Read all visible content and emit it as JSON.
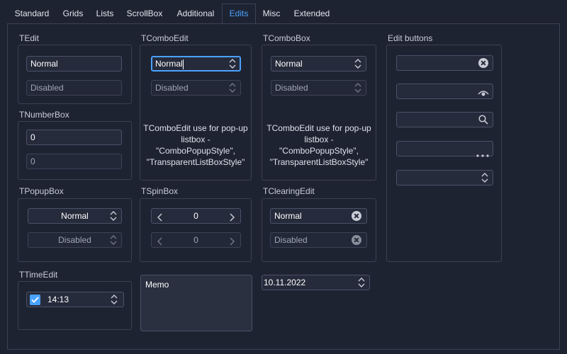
{
  "tabs": [
    "Standard",
    "Grids",
    "Lists",
    "ScrollBox",
    "Additional",
    "Edits",
    "Misc",
    "Extended"
  ],
  "active_tab": "Edits",
  "tedit": {
    "title": "TEdit",
    "normal": "Normal",
    "disabled": "Disabled"
  },
  "tnumberbox": {
    "title": "TNumberBox",
    "value1": "0",
    "value2": "0"
  },
  "tpopupbox": {
    "title": "TPopupBox",
    "normal": "Normal",
    "disabled": "Disabled"
  },
  "ttimeedit": {
    "title": "TTimeEdit",
    "value": "14:13"
  },
  "tcomboedit": {
    "title": "TComboEdit",
    "normal": "Normal",
    "disabled": "Disabled",
    "hint": [
      "TComboEdit use for pop-up",
      "listbox -",
      "\"ComboPopupStyle\",",
      "\"TransparentListBoxStyle\""
    ]
  },
  "tspinbox": {
    "title": "TSpinBox",
    "value1": "0",
    "value2": "0"
  },
  "memo": {
    "text": "Memo"
  },
  "tcombobox": {
    "title": "TComboBox",
    "normal": "Normal",
    "disabled": "Disabled",
    "hint": [
      "TComboEdit use for pop-up",
      "listbox -",
      "\"ComboPopupStyle\",",
      "\"TransparentListBoxStyle\""
    ]
  },
  "tclearingedit": {
    "title": "TClearingEdit",
    "normal": "Normal",
    "disabled": "Disabled"
  },
  "dateedit": {
    "value": "10.11.2022"
  },
  "editbuttons": {
    "title": "Edit buttons",
    "icons": [
      "clear-icon",
      "password-eye-icon",
      "search-icon",
      "ellipsis-icon",
      "updown-icon"
    ]
  },
  "colors": {
    "background": "#1e2332",
    "accent": "#4aa3ff",
    "border": "#3a4152"
  }
}
